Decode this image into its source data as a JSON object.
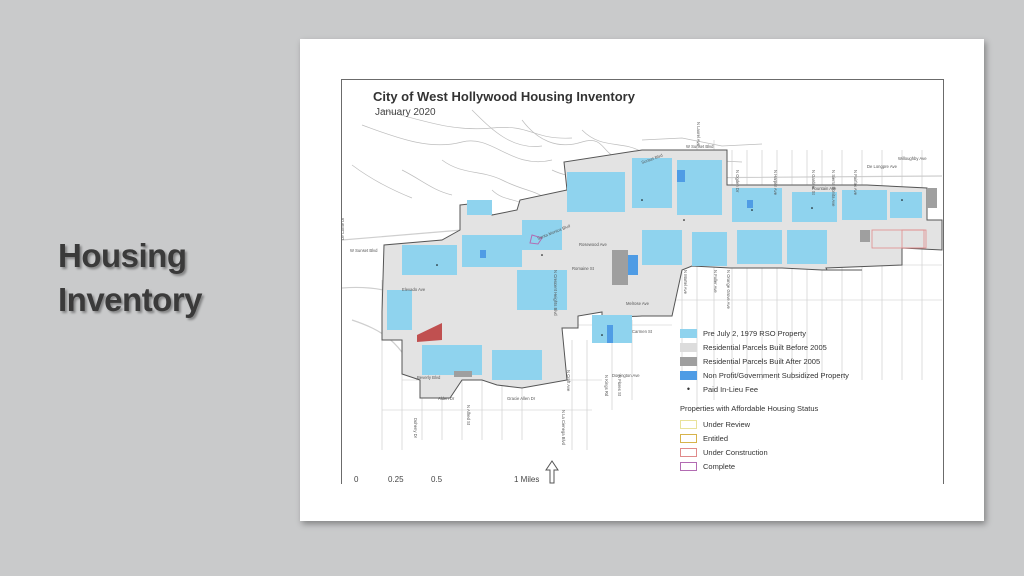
{
  "slide": {
    "title_line1": "Housing",
    "title_line2": "Inventory"
  },
  "map": {
    "title": "City of West Hollywood Housing Inventory",
    "subtitle": "January 2020",
    "street_labels": [
      "N Laurel Ave",
      "W Sunset Blvd",
      "Sunset Blvd",
      "De Longpre Ave",
      "Fountain Ave",
      "Santa Monica Blvd",
      "Melrose Ave",
      "Beverly Blvd",
      "Rosewood Ave",
      "Romaine St",
      "Willoughby Ave",
      "Alden Dr",
      "Gracie Allen Dr",
      "Doheny Dr",
      "N La Cienega Blvd",
      "N Fairfax Ave",
      "N Gardner St",
      "N Sierra Bonita Ave",
      "N Harper Ave",
      "N Ogden Dr",
      "Carmen St",
      "Dorrington Ave",
      "Elevado Ave",
      "Le Conte Dr",
      "N Orange Grove Ave",
      "N Fuller Ave",
      "N Martel Ave",
      "N Croft Ave",
      "N Kings Rd",
      "N Flores St",
      "N Alfred St",
      "N Crescent Heights Blvd",
      "W Sunset Blvd"
    ],
    "legend": {
      "items": [
        {
          "label": "Pre July 2, 1979 RSO Property",
          "color": "#8fd3ee"
        },
        {
          "label": "Residential Parcels Built Before 2005",
          "color": "#dcdcdc"
        },
        {
          "label": "Residential Parcels Built After 2005",
          "color": "#9f9f9f"
        },
        {
          "label": "Non Profit/Government Subsidized Property",
          "color": "#4f9ce5"
        },
        {
          "label": "Paid In-Lieu Fee",
          "color": "#000000"
        }
      ],
      "status_heading": "Properties with Affordable Housing Status",
      "status_items": [
        {
          "label": "Under Review",
          "color": "#e9e29a"
        },
        {
          "label": "Entitled",
          "color": "#d7b34a"
        },
        {
          "label": "Under Construction",
          "color": "#e08a8a"
        },
        {
          "label": "Complete",
          "color": "#b26bb2"
        }
      ]
    },
    "scale_bar": {
      "ticks": [
        "0",
        "0.25",
        "0.5",
        "1 Miles"
      ]
    }
  }
}
